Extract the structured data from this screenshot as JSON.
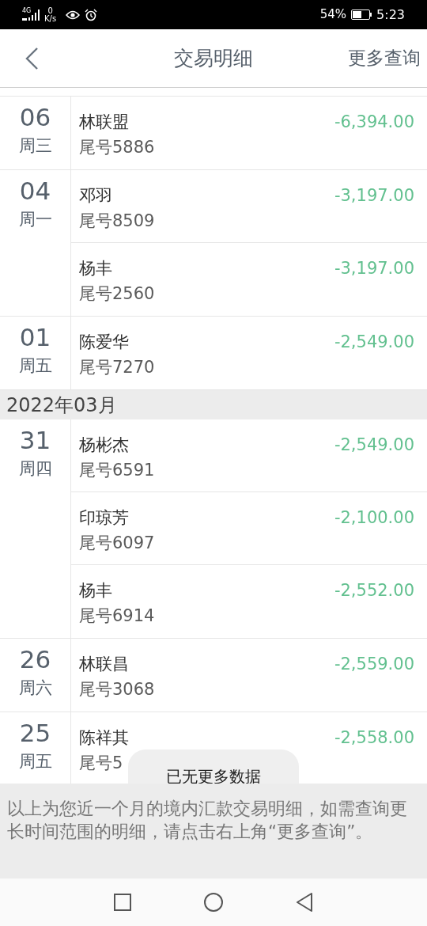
{
  "status_bar": {
    "network": "4G",
    "speed_value": "0",
    "speed_unit": "K/s",
    "battery_percent": "54%",
    "time": "5:23"
  },
  "header": {
    "title": "交易明细",
    "action": "更多查询"
  },
  "sections": [
    {
      "kind": "day",
      "day": "06",
      "weekday": "周三",
      "entries": [
        {
          "name": "林联盟",
          "account": "尾号5886",
          "amount": "-6,394.00"
        }
      ]
    },
    {
      "kind": "day",
      "day": "04",
      "weekday": "周一",
      "entries": [
        {
          "name": "邓羽",
          "account": "尾号8509",
          "amount": "-3,197.00"
        },
        {
          "name": "杨丰",
          "account": "尾号2560",
          "amount": "-3,197.00"
        }
      ]
    },
    {
      "kind": "day",
      "day": "01",
      "weekday": "周五",
      "entries": [
        {
          "name": "陈爱华",
          "account": "尾号7270",
          "amount": "-2,549.00"
        }
      ]
    },
    {
      "kind": "month",
      "label": "2022年03月"
    },
    {
      "kind": "day",
      "day": "31",
      "weekday": "周四",
      "entries": [
        {
          "name": "杨彬杰",
          "account": "尾号6591",
          "amount": "-2,549.00"
        },
        {
          "name": "印琼芳",
          "account": "尾号6097",
          "amount": "-2,100.00"
        },
        {
          "name": "杨丰",
          "account": "尾号6914",
          "amount": "-2,552.00"
        }
      ]
    },
    {
      "kind": "day",
      "day": "26",
      "weekday": "周六",
      "entries": [
        {
          "name": "林联昌",
          "account": "尾号3068",
          "amount": "-2,559.00"
        }
      ]
    },
    {
      "kind": "day",
      "day": "25",
      "weekday": "周五",
      "entries": [
        {
          "name": "陈祥其",
          "account": "尾号5",
          "amount": "-2,558.00"
        }
      ]
    }
  ],
  "toast": "已无更多数据",
  "footer_note": "以上为您近一个月的境内汇款交易明细，如需查询更长时间范围的明细，请点击右上角“更多查询”。"
}
